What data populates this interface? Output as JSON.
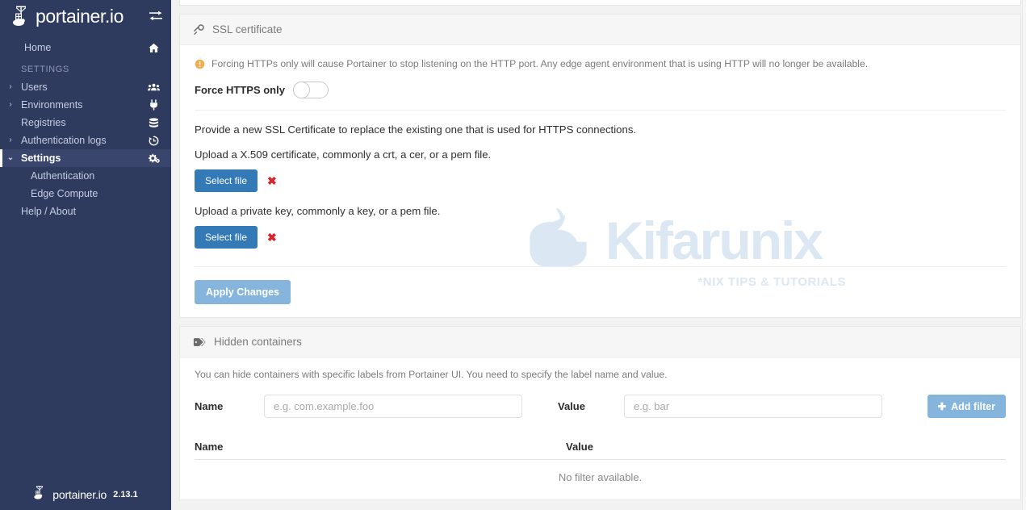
{
  "sidebar": {
    "brand": {
      "text": "portainer.io",
      "logo_icon": "portainer-crane-icon",
      "toggle_icon": "expand-collapse-icon"
    },
    "home": {
      "label": "Home",
      "icon": "home-icon"
    },
    "section_label": "SETTINGS",
    "items": [
      {
        "label": "Users",
        "icon": "users-icon",
        "caret": "›",
        "expandable": true
      },
      {
        "label": "Environments",
        "icon": "plug-icon",
        "caret": "›",
        "expandable": true
      },
      {
        "label": "Registries",
        "icon": "database-icon",
        "caret": "",
        "expandable": false
      },
      {
        "label": "Authentication logs",
        "icon": "history-icon",
        "caret": "›",
        "expandable": true
      },
      {
        "label": "Settings",
        "icon": "gears-icon",
        "caret": "⌄",
        "expandable": true,
        "active": true
      }
    ],
    "sub_items": [
      {
        "label": "Authentication"
      },
      {
        "label": "Edge Compute"
      }
    ],
    "help": {
      "label": "Help / About"
    },
    "footer": {
      "text": "portainer.io",
      "version": "2.13.1",
      "logo_icon": "portainer-crane-icon"
    }
  },
  "ssl_panel": {
    "title": "SSL certificate",
    "icon": "key-icon",
    "warning": "Forcing HTTPs only will cause Portainer to stop listening on the HTTP port. Any edge agent environment that is using HTTP will no longer be available.",
    "warning_icon": "exclamation-circle-icon",
    "toggle_label": "Force HTTPS only",
    "toggle_state": "off",
    "provide_text": "Provide a new SSL Certificate to replace the existing one that is used for HTTPS connections.",
    "upload_cert_text": "Upload a X.509 certificate, commonly a crt, a cer, or a pem file.",
    "select_file_cert_label": "Select file",
    "clear_cert_icon": "x-mark-icon",
    "upload_key_text": "Upload a private key, commonly a key, or a pem file.",
    "select_file_key_label": "Select file",
    "clear_key_icon": "x-mark-icon",
    "apply_label": "Apply Changes"
  },
  "hidden_panel": {
    "title": "Hidden containers",
    "icon": "tag-icon",
    "description": "You can hide containers with specific labels from Portainer UI. You need to specify the label name and value.",
    "name_label": "Name",
    "name_placeholder": "e.g. com.example.foo",
    "name_value": "",
    "value_label": "Value",
    "value_placeholder": "e.g. bar",
    "value_value": "",
    "add_filter_label": "Add filter",
    "add_filter_icon": "plus-icon",
    "table": {
      "columns": [
        "Name",
        "Value"
      ],
      "rows": [],
      "empty_text": "No filter available."
    }
  },
  "watermark": {
    "text": "Kifarunix",
    "subtitle": "*NIX TIPS & TUTORIALS",
    "icon": "rhino-icon"
  },
  "colors": {
    "sidebar_bg": "#2f3a5f",
    "sidebar_active": "#3a456d",
    "primary_button": "#337ab7",
    "muted_button": "#85b5dd",
    "danger": "#d9232d",
    "warning": "#f0ad4e",
    "page_bg": "#f2f2f2",
    "watermark": "#dbe7f2"
  }
}
